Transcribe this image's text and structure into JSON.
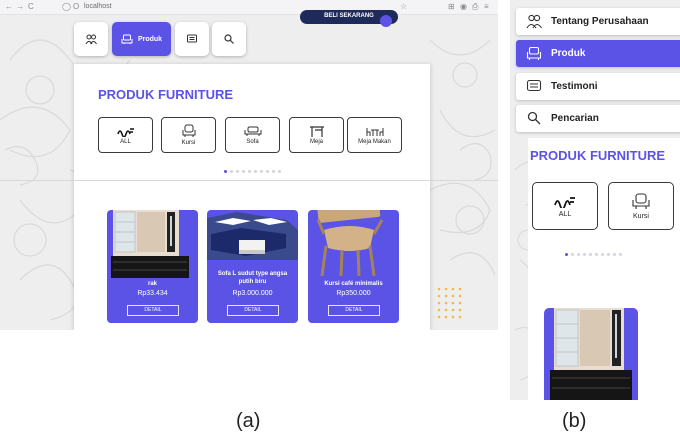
{
  "panel_a": {
    "browser": {
      "nav_icons": [
        "←",
        "→",
        "C"
      ],
      "url_prefix_icons": [
        "◯",
        "Ο"
      ],
      "url_text": "localhost",
      "right_icons": [
        "☆",
        "⊞",
        "◉",
        "⎙",
        "≡"
      ]
    },
    "header_button_label": "BELI SEKARANG",
    "tabs": [
      {
        "label": "",
        "icon": "people-icon"
      },
      {
        "label": "Produk",
        "icon": "sofa-icon"
      },
      {
        "label": "",
        "icon": "message-icon"
      },
      {
        "label": "",
        "icon": "search-icon"
      }
    ],
    "section_title": "PRODUK FURNITURE",
    "categories": [
      {
        "label": "ALL",
        "icon": "wave-icon"
      },
      {
        "label": "Kursi",
        "icon": "armchair-icon"
      },
      {
        "label": "Sofa",
        "icon": "sofa-icon"
      },
      {
        "label": "Meja",
        "icon": "table-icon"
      },
      {
        "label": "Meja Makan",
        "icon": "dining-table-icon"
      }
    ],
    "products": [
      {
        "name": "rak",
        "price": "Rp33.434",
        "button": "DETAIL"
      },
      {
        "name": "Sofa L sudut type angsa putih biru",
        "price": "Rp3.000.000",
        "button": "DETAIL"
      },
      {
        "name": "Kursi café minimalis",
        "price": "Rp350.000",
        "button": "DETAIL"
      }
    ],
    "caption": "(a)"
  },
  "panel_b": {
    "menu": [
      {
        "label": "Tentang Perusahaan",
        "icon": "people-icon",
        "active": false
      },
      {
        "label": "Produk",
        "icon": "sofa-icon",
        "active": true
      },
      {
        "label": "Testimoni",
        "icon": "message-icon",
        "active": false
      },
      {
        "label": "Pencarian",
        "icon": "search-icon",
        "active": false
      }
    ],
    "section_title": "PRODUK FURNITURE",
    "categories": [
      {
        "label": "ALL",
        "icon": "wave-icon"
      },
      {
        "label": "Kursi",
        "icon": "armchair-icon"
      }
    ],
    "caption": "(b)"
  },
  "colors": {
    "accent": "#5b53e6",
    "dark": "#1e2a5a",
    "dot_yellow": "#f2b84b"
  }
}
